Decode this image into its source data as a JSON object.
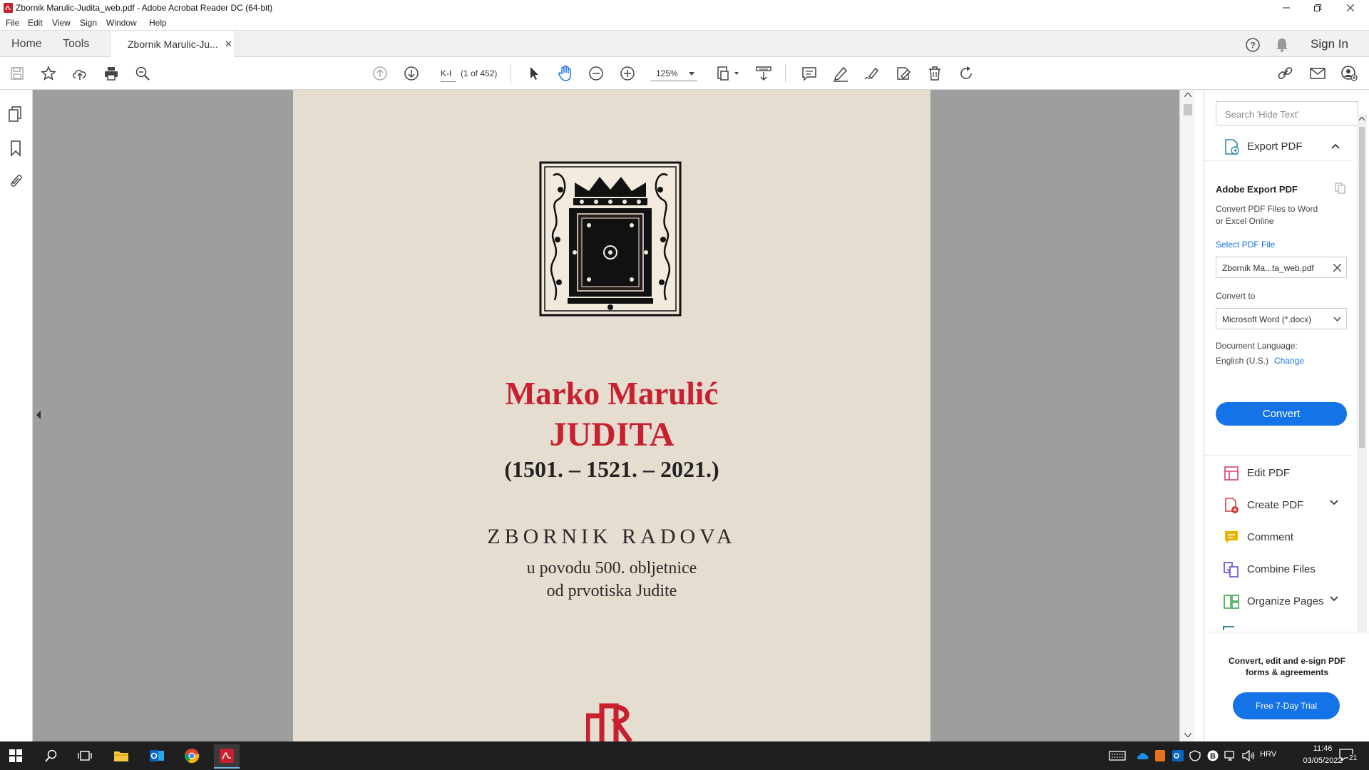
{
  "window": {
    "title": "Zbornik Marulic-Judita_web.pdf - Adobe Acrobat Reader DC (64-bit)"
  },
  "menu": [
    "File",
    "Edit",
    "View",
    "Sign",
    "Window",
    "Help"
  ],
  "tabs": {
    "home": "Home",
    "tools": "Tools",
    "document": "Zbornik Marulic-Ju...",
    "sign_in": "Sign In"
  },
  "toolbar": {
    "page_label": "K-I",
    "page_count": "(1 of 452)",
    "zoom": "125%"
  },
  "pdf_page": {
    "author": "Marko Marulić",
    "title": "JUDITA",
    "years": "(1501. – 1521. – 2021.)",
    "subtitle": "ZBORNIK RADOVA",
    "line1": "u povodu 500. obljetnice",
    "line2": "od prvotiska Judite"
  },
  "right_panel": {
    "search_placeholder": "Search 'Hide Text'",
    "export_header": "Export PDF",
    "adobe_export_title": "Adobe Export PDF",
    "adobe_export_desc1": "Convert PDF Files to Word",
    "adobe_export_desc2": "or Excel Online",
    "select_file_label": "Select PDF File",
    "selected_file": "Zbornik Ma...ta_web.pdf",
    "convert_to_label": "Convert to",
    "convert_format": "Microsoft Word (*.docx)",
    "doc_lang_label": "Document Language:",
    "doc_lang_value": "English (U.S.)",
    "change_link": "Change",
    "convert_button": "Convert",
    "tools": [
      {
        "label": "Edit PDF"
      },
      {
        "label": "Create PDF"
      },
      {
        "label": "Comment"
      },
      {
        "label": "Combine Files"
      },
      {
        "label": "Organize Pages"
      }
    ],
    "promo_line1": "Convert, edit and e-sign PDF",
    "promo_line2": "forms & agreements",
    "trial_button": "Free 7-Day Trial"
  },
  "taskbar": {
    "language": "HRV",
    "time": "11:46",
    "date": "03/05/2022",
    "notifications": "21"
  },
  "colors": {
    "accent": "#1473e6",
    "title_red": "#c8202f",
    "taskbar": "#1f1f1f",
    "page": "#e6ddd1"
  }
}
